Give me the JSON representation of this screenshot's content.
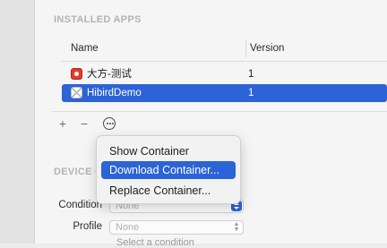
{
  "installed_apps": {
    "section_title": "INSTALLED APPS",
    "columns": {
      "name": "Name",
      "version": "Version"
    },
    "rows": [
      {
        "name": "大方-测试",
        "version": "1",
        "icon": "red-app-icon",
        "selected": false
      },
      {
        "name": "HibirdDemo",
        "version": "1",
        "icon": "placeholder-app-icon",
        "selected": true
      }
    ],
    "toolbar": {
      "add": "+",
      "remove": "−"
    }
  },
  "context_menu": {
    "items": [
      {
        "label": "Show Container",
        "highlighted": false
      },
      {
        "label": "Download Container...",
        "highlighted": true
      },
      {
        "label": "Replace Container...",
        "highlighted": false
      }
    ]
  },
  "device_conditions": {
    "section_title": "DEVICE C",
    "condition": {
      "label": "Condition",
      "value": "None"
    },
    "profile": {
      "label": "Profile",
      "value": "None"
    },
    "truncated_text": "Select a condition"
  },
  "colors": {
    "accent": "#2c63d6",
    "section_title": "#b3b3b3"
  }
}
